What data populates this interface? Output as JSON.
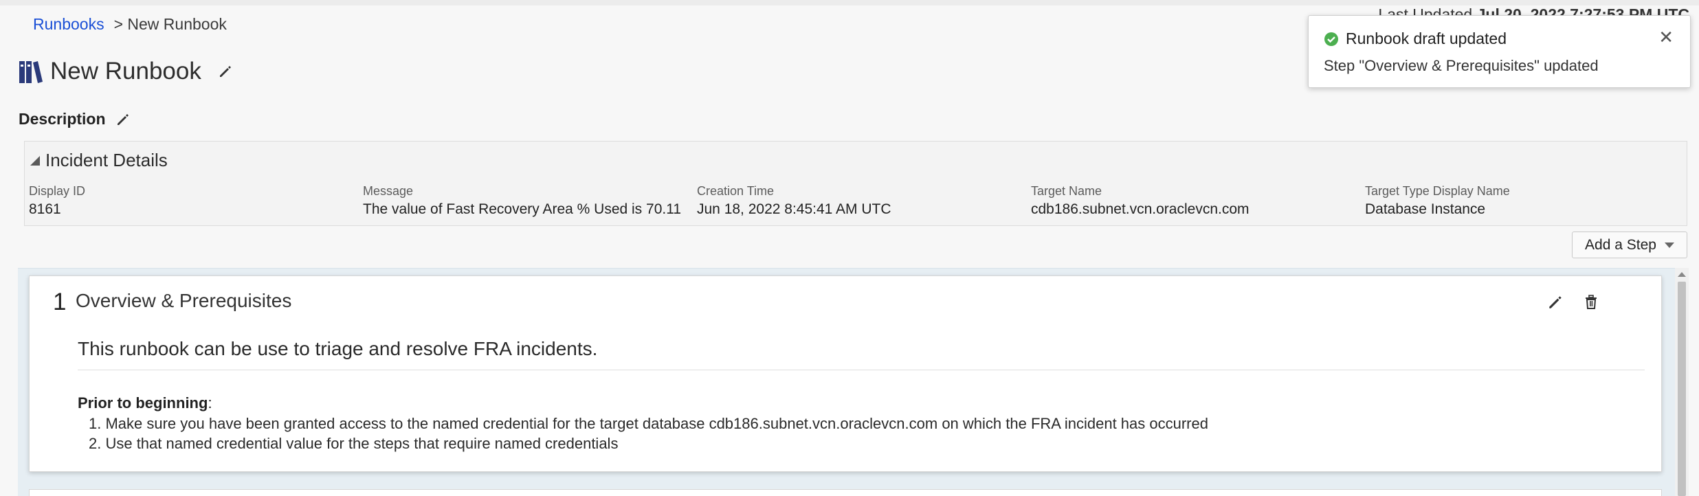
{
  "breadcrumb": {
    "root": "Runbooks",
    "current": "> New Runbook"
  },
  "last_updated": {
    "label": "Last Updated",
    "value": "Jul 20, 2022 7:27:53 PM UTC"
  },
  "page": {
    "title": "New Runbook",
    "description_label": "Description"
  },
  "incident": {
    "title": "Incident Details",
    "fields": [
      {
        "label": "Display ID",
        "value": "8161"
      },
      {
        "label": "Message",
        "value": "The value of Fast Recovery Area % Used is 70.11"
      },
      {
        "label": "Creation Time",
        "value": "Jun 18, 2022 8:45:41 AM UTC"
      },
      {
        "label": "Target Name",
        "value": "cdb186.subnet.vcn.oraclevcn.com"
      },
      {
        "label": "Target Type Display Name",
        "value": "Database Instance"
      }
    ]
  },
  "add_step_label": "Add a Step",
  "step": {
    "number": "1",
    "title": "Overview & Prerequisites",
    "description": "This runbook can be use to triage and resolve FRA incidents.",
    "prior_label": "Prior to beginning",
    "prior_colon": ":",
    "items": [
      "1. Make sure you have been granted access to the named credential for the target database cdb186.subnet.vcn.oraclevcn.com on which the FRA incident has occurred",
      "2. Use that named credential value for the steps that require named credentials"
    ]
  },
  "toast": {
    "title": "Runbook draft updated",
    "message": "Step \"Overview & Prerequisites\" updated",
    "close": "✕"
  },
  "colors": {
    "link": "#1a4fd6",
    "success": "#4caf50",
    "icon_navy": "#2b3a7a"
  },
  "icons": [
    "runbook-book-icon",
    "pencil-icon",
    "trash-icon",
    "check-circle-icon",
    "close-icon",
    "collapse-triangle-icon",
    "dropdown-caret-icon"
  ]
}
